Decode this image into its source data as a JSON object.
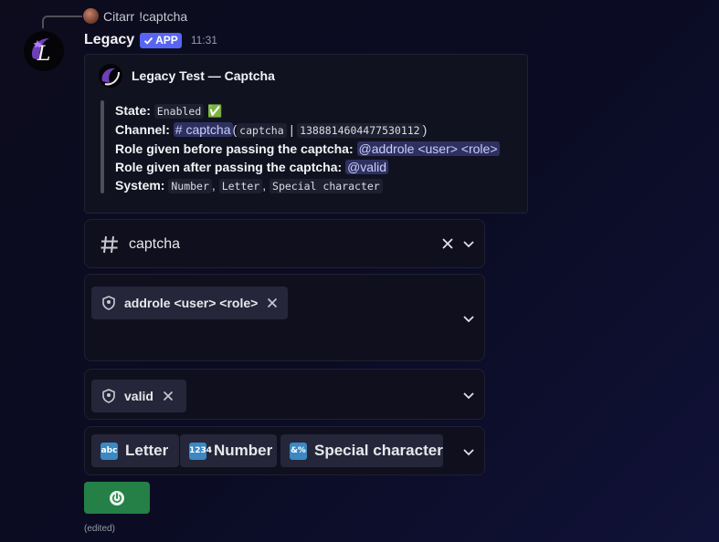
{
  "reply": {
    "author": "Citarr",
    "text": "!captcha"
  },
  "message": {
    "username": "Legacy",
    "badge": "APP",
    "timestamp": "11:31",
    "edited_label": "(edited)"
  },
  "embed": {
    "author": "Legacy Test — Captcha",
    "fields": {
      "state_label": "State:",
      "state_value": "Enabled",
      "state_emoji": "✅",
      "channel_label": "Channel:",
      "channel_mention": "# captcha",
      "channel_paren_open": "(",
      "channel_code": "captcha",
      "channel_sep": "|",
      "channel_id": "1388814604477530112",
      "channel_paren_close": ")",
      "role_before_label": "Role given before passing the captcha:",
      "role_before_value": "@addrole <user> <role>",
      "role_after_label": "Role given after passing the captcha:",
      "role_after_value": "@valid",
      "system_label": "System:",
      "system_values": [
        "Number",
        "Letter",
        "Special character"
      ]
    }
  },
  "selects": {
    "channel": {
      "value": "captcha",
      "icon": "hashtag-icon"
    },
    "role_before": {
      "chip": "addrole <user> <role>",
      "icon": "role-shield-icon"
    },
    "role_after": {
      "chip": "valid",
      "icon": "role-shield-icon"
    },
    "system": {
      "chips": [
        {
          "emoji": "🔤",
          "label": "Letter"
        },
        {
          "emoji": "🔢",
          "label": "Number"
        },
        {
          "emoji": "🔣",
          "label": "Special character"
        }
      ]
    }
  },
  "colors": {
    "app_badge": "#5865f2",
    "power_button": "#248046",
    "mention_bg": "#2e3160",
    "check": "#43a25a"
  }
}
